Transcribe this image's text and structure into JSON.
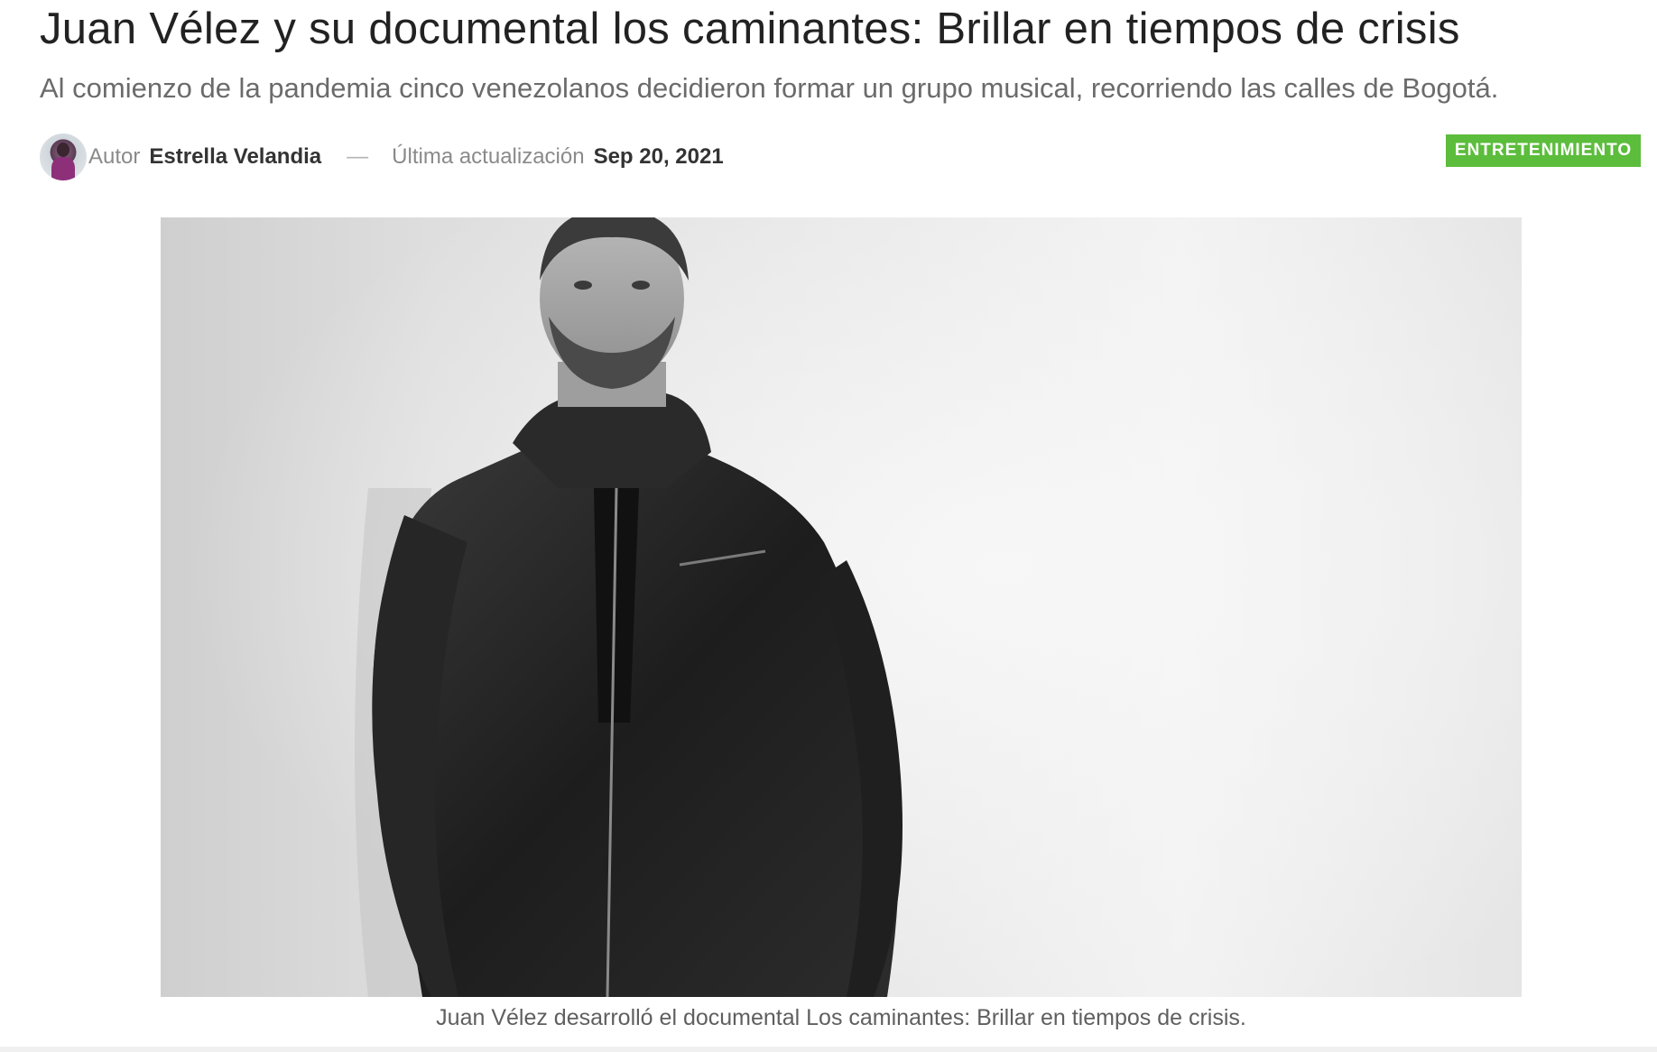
{
  "article": {
    "title": "Juan Vélez y su documental los caminantes: Brillar en tiempos de crisis",
    "subtitle": "Al comienzo de la pandemia cinco venezolanos decidieron formar un grupo musical, recorriendo las calles de Bogotá.",
    "category": "ENTRETENIMIENTO",
    "category_color": "#5cbd3c"
  },
  "meta": {
    "author_label": "Autor",
    "author_name": "Estrella Velandia",
    "separator": "—",
    "updated_label": "Última actualización",
    "updated_date": "Sep 20, 2021"
  },
  "featured_image": {
    "caption": "Juan Vélez desarrolló el documental Los caminantes: Brillar en tiempos de crisis."
  }
}
